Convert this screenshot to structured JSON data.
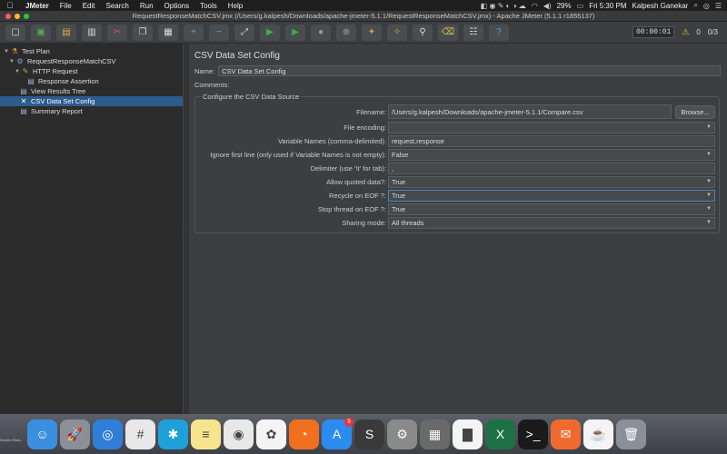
{
  "menubar": {
    "items": [
      "JMeter",
      "File",
      "Edit",
      "Search",
      "Run",
      "Options",
      "Tools",
      "Help"
    ],
    "battery": "29%",
    "clock": "Fri 5:30 PM",
    "user": "Kalpesh Ganekar"
  },
  "window": {
    "title": "RequestResponseMatchCSV.jmx (/Users/g.kalpesh/Downloads/apache-jmeter-5.1.1/RequestResponseMatchCSV.jmx) - Apache JMeter (5.1.1 r1855137)"
  },
  "toolbar": {
    "timer": "00:00:01",
    "warnings": "0",
    "threads": "0/3",
    "icons": [
      "new-icon",
      "templates-icon",
      "open-icon",
      "save-icon",
      "cut-icon",
      "copy-icon",
      "paste-icon",
      "expand-icon",
      "collapse-icon",
      "toggle-icon",
      "start-icon",
      "start-no-pause-icon",
      "stop-icon",
      "shutdown-icon",
      "clear-icon",
      "clear-all-icon",
      "search-icon",
      "reset-search-icon",
      "function-helper-icon",
      "help-icon"
    ]
  },
  "tree": {
    "items": [
      {
        "label": "Test Plan",
        "level": 0,
        "arrow": "▼",
        "icon": "test-plan-icon"
      },
      {
        "label": "RequestResponseMatchCSV",
        "level": 1,
        "arrow": "▼",
        "icon": "thread-group-icon"
      },
      {
        "label": "HTTP Request",
        "level": 2,
        "arrow": "▼",
        "icon": "http-sampler-icon"
      },
      {
        "label": "Response Assertion",
        "level": 3,
        "arrow": "",
        "icon": "assertion-icon"
      },
      {
        "label": "View Results Tree",
        "level": 2,
        "arrow": "",
        "icon": "listener-icon"
      },
      {
        "label": "CSV Data Set Config",
        "level": 2,
        "arrow": "",
        "icon": "config-icon",
        "selected": true
      },
      {
        "label": "Summary Report",
        "level": 2,
        "arrow": "",
        "icon": "listener-icon"
      }
    ]
  },
  "panel": {
    "title": "CSV Data Set Config",
    "name_label": "Name:",
    "name_value": "CSV Data Set Config",
    "comments_label": "Comments:",
    "group_title": "Configure the CSV Data Source",
    "fields": {
      "filename": {
        "label": "Filename:",
        "value": "/Users/g.kalpesh/Downloads/apache-jmeter-5.1.1/Compare.csv"
      },
      "browse": "Browse...",
      "encoding": {
        "label": "File encoding:",
        "value": ""
      },
      "varnames": {
        "label": "Variable Names (comma-delimited):",
        "value": "request,response"
      },
      "ignore_first": {
        "label": "Ignore first line (only used if Variable Names is not empty):",
        "value": "False"
      },
      "delimiter": {
        "label": "Delimiter (use '\\t' for tab):",
        "value": ","
      },
      "quoted": {
        "label": "Allow quoted data?:",
        "value": "True"
      },
      "recycle": {
        "label": "Recycle on EOF ?:",
        "value": "True"
      },
      "stop_thread": {
        "label": "Stop thread on EOF ?:",
        "value": "True"
      },
      "sharing": {
        "label": "Sharing mode:",
        "value": "All threads"
      }
    }
  },
  "dock": {
    "apps": [
      {
        "name": "finder-icon",
        "color": "#3a8fe0"
      },
      {
        "name": "launchpad-icon",
        "color": "#8a8f98"
      },
      {
        "name": "safari-icon",
        "color": "#2f7fd8"
      },
      {
        "name": "slack-icon",
        "color": "#e8e8e8"
      },
      {
        "name": "trello-icon",
        "color": "#1ea0d8"
      },
      {
        "name": "notes-icon",
        "color": "#f6e58d"
      },
      {
        "name": "chrome-icon",
        "color": "#e8e8e8"
      },
      {
        "name": "photos-icon",
        "color": "#f4f4f4"
      },
      {
        "name": "firefox-icon",
        "color": "#f07020"
      },
      {
        "name": "app-store-icon",
        "color": "#2a8cf0",
        "badge": "9"
      },
      {
        "name": "sublime-icon",
        "color": "#3a3a3a"
      },
      {
        "name": "system-preferences-icon",
        "color": "#8a8a8a"
      },
      {
        "name": "calculator-icon",
        "color": "#6a6a6a"
      },
      {
        "name": "activity-monitor-icon",
        "color": "#f4f4f4"
      },
      {
        "name": "excel-icon",
        "color": "#1e7145"
      },
      {
        "name": "terminal-icon",
        "color": "#1a1a1a"
      },
      {
        "name": "postman-icon",
        "color": "#f06a30"
      },
      {
        "name": "java-icon",
        "color": "#f4f4f4"
      },
      {
        "name": "trash-icon",
        "color": "#8a8f98"
      }
    ],
    "desk_label": "Screen Shot..."
  }
}
